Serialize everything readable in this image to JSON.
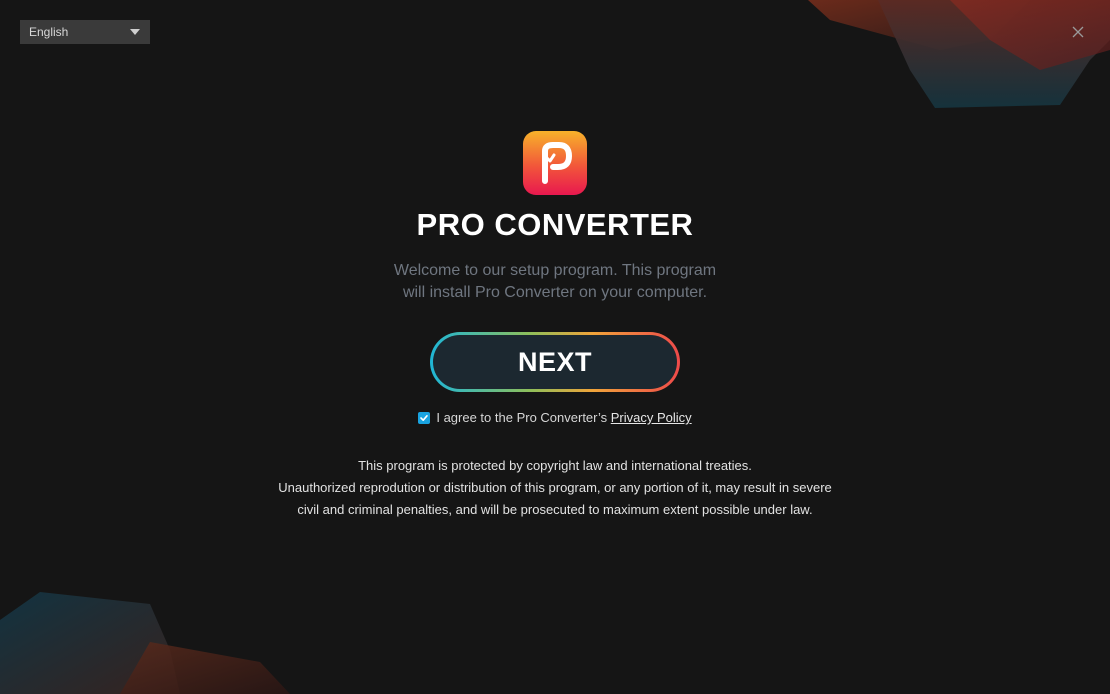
{
  "language_select": {
    "selected": "English",
    "icon": "chevron-down-icon"
  },
  "close_icon": "close-icon",
  "app": {
    "title": "PRO CONVERTER",
    "logo_icon": "pro-converter-logo-icon",
    "welcome_line1": "Welcome to our setup program. This program",
    "welcome_line2": "will install Pro Converter on your computer."
  },
  "next_button": {
    "label": "NEXT"
  },
  "agreement": {
    "checked": true,
    "text": "I agree to the Pro Converter’s ",
    "link_label": "Privacy Policy"
  },
  "legal": {
    "line1": "This program is protected by copyright law and international treaties.",
    "line2": "Unauthorized reprodution or distribution of this program, or any portion of it, may result in severe",
    "line3": "civil and criminal penalties, and will be prosecuted to maximum extent possible under law."
  },
  "colors": {
    "background": "#151515",
    "button_fill": "#1c2830",
    "gradient_start": "#1fb6d6",
    "gradient_end": "#ee4a4a",
    "checkbox": "#19a3e0",
    "welcome_text": "#6f7680"
  }
}
